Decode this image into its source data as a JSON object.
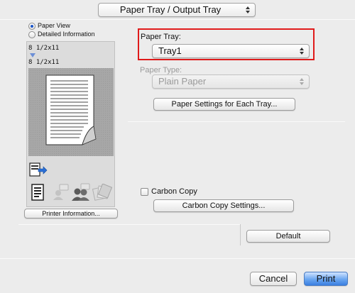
{
  "header": {
    "panel_menu_value": "Paper Tray / Output Tray"
  },
  "preview": {
    "view_modes": [
      {
        "label": "Paper View",
        "selected": true
      },
      {
        "label": "Detailed Information",
        "selected": false
      }
    ],
    "original_size": "8 1/2x11",
    "output_size": "8 1/2x11",
    "printer_info_button": "Printer Information..."
  },
  "paper_tray": {
    "label": "Paper Tray:",
    "value": "Tray1",
    "highlight_color": "#e01a1a"
  },
  "paper_type": {
    "label": "Paper Type:",
    "value": "Plain Paper",
    "enabled": false
  },
  "paper_settings_button": "Paper Settings for Each Tray...",
  "carbon_copy": {
    "label": "Carbon Copy",
    "checked": false,
    "settings_button": "Carbon Copy Settings..."
  },
  "footer": {
    "default_button": "Default",
    "cancel_button": "Cancel",
    "print_button": "Print",
    "accent_color": "#3a7fe0"
  }
}
